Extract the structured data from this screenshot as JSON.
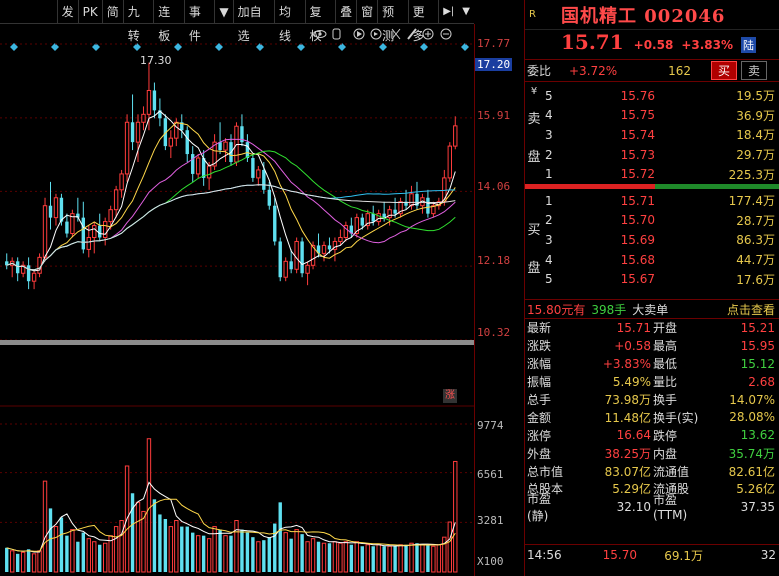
{
  "toolbar": {
    "buttons": [
      "发",
      "PK",
      "简",
      "九转",
      "连板",
      "事件",
      "▼",
      "加自选",
      "均线",
      "复权",
      "叠",
      "窗",
      "预测",
      "更多"
    ],
    "end_arrow": "▶|",
    "dropdown": "▼"
  },
  "price_axis": {
    "labels": [
      "17.77",
      "15.91",
      "14.06",
      "12.18",
      "10.32"
    ],
    "highlight": "17.20",
    "max_label": "17.30"
  },
  "volume_axis": {
    "labels": [
      "9774",
      "6561",
      "3281",
      "X100"
    ],
    "badge": "涨"
  },
  "quote": {
    "badge": "R",
    "name": "国机精工 002046",
    "price": "15.71",
    "change": "+0.58",
    "change_pct": "+3.83%",
    "exchange": "陆"
  },
  "weibi": {
    "label": "委比",
    "value": "+3.72%",
    "diff": "162",
    "buy_label": "买",
    "sell_label": "卖"
  },
  "sell_side": {
    "label": "卖盘",
    "top_mark": "¥",
    "rows": [
      {
        "level": "5",
        "price": "15.76",
        "volume": "19.5万"
      },
      {
        "level": "4",
        "price": "15.75",
        "volume": "36.9万"
      },
      {
        "level": "3",
        "price": "15.74",
        "volume": "18.4万"
      },
      {
        "level": "2",
        "price": "15.73",
        "volume": "29.7万"
      },
      {
        "level": "1",
        "price": "15.72",
        "volume": "225.3万"
      }
    ]
  },
  "buy_side": {
    "label": "买盘",
    "rows": [
      {
        "level": "1",
        "price": "15.71",
        "volume": "177.4万"
      },
      {
        "level": "2",
        "price": "15.70",
        "volume": "28.7万"
      },
      {
        "level": "3",
        "price": "15.69",
        "volume": "86.3万"
      },
      {
        "level": "4",
        "price": "15.68",
        "volume": "44.7万"
      },
      {
        "level": "5",
        "price": "15.67",
        "volume": "17.6万"
      }
    ]
  },
  "big_order": {
    "price": "15.80元有",
    "qty": "398手",
    "label": "大卖单",
    "link": "点击查看"
  },
  "stats": [
    {
      "l1": "最新",
      "v1": "15.71",
      "c1": "red",
      "l2": "开盘",
      "v2": "15.21",
      "c2": "red"
    },
    {
      "l1": "涨跌",
      "v1": "+0.58",
      "c1": "red",
      "l2": "最高",
      "v2": "15.95",
      "c2": "red"
    },
    {
      "l1": "涨幅",
      "v1": "+3.83%",
      "c1": "red",
      "l2": "最低",
      "v2": "15.12",
      "c2": "green"
    },
    {
      "l1": "振幅",
      "v1": "5.49%",
      "c1": "yellow",
      "l2": "量比",
      "v2": "2.68",
      "c2": "red"
    },
    {
      "l1": "总手",
      "v1": "73.98万",
      "c1": "yellow",
      "l2": "换手",
      "v2": "14.07%",
      "c2": "yellow"
    },
    {
      "l1": "金额",
      "v1": "11.48亿",
      "c1": "yellow",
      "l2": "换手(实)",
      "v2": "28.08%",
      "c2": "yellow"
    },
    {
      "l1": "涨停",
      "v1": "16.64",
      "c1": "red",
      "l2": "跌停",
      "v2": "13.62",
      "c2": "green"
    },
    {
      "l1": "外盘",
      "v1": "38.25万",
      "c1": "red",
      "l2": "内盘",
      "v2": "35.74万",
      "c2": "green"
    },
    {
      "l1": "总市值",
      "v1": "83.07亿",
      "c1": "yellow",
      "l2": "流通值",
      "v2": "82.61亿",
      "c2": "yellow"
    },
    {
      "l1": "总股本",
      "v1": "5.29亿",
      "c1": "yellow",
      "l2": "流通股",
      "v2": "5.26亿",
      "c2": "yellow"
    },
    {
      "l1": "市盈(静)",
      "v1": "32.10",
      "c1": "white",
      "l2": "市盈(TTM)",
      "v2": "37.35",
      "c2": "white"
    }
  ],
  "ticks": [
    {
      "time": "14:56",
      "price": "15.70",
      "vol": "69.1万",
      "n": "32"
    }
  ],
  "chart_data": {
    "type": "candlestick",
    "ylim": [
      10.32,
      17.77
    ],
    "candles": [
      [
        12.3,
        12.5,
        12.1,
        12.2
      ],
      [
        12.2,
        12.4,
        11.9,
        12.3
      ],
      [
        12.3,
        12.4,
        11.8,
        12.0
      ],
      [
        12.0,
        12.3,
        11.9,
        12.2
      ],
      [
        12.2,
        12.4,
        11.6,
        11.8
      ],
      [
        11.8,
        12.1,
        11.6,
        12.0
      ],
      [
        12.0,
        12.5,
        11.9,
        12.4
      ],
      [
        12.4,
        13.9,
        12.3,
        13.7
      ],
      [
        13.7,
        14.3,
        13.1,
        13.4
      ],
      [
        13.4,
        14.0,
        13.2,
        13.9
      ],
      [
        13.9,
        14.0,
        13.2,
        13.3
      ],
      [
        13.3,
        13.5,
        12.9,
        13.0
      ],
      [
        13.0,
        13.6,
        12.9,
        13.5
      ],
      [
        13.5,
        13.9,
        13.3,
        13.4
      ],
      [
        13.4,
        13.8,
        12.5,
        12.6
      ],
      [
        12.6,
        13.2,
        12.4,
        12.9
      ],
      [
        12.9,
        13.3,
        12.5,
        13.2
      ],
      [
        13.2,
        13.5,
        12.8,
        12.9
      ],
      [
        12.9,
        13.4,
        12.7,
        13.3
      ],
      [
        13.3,
        13.7,
        13.1,
        13.6
      ],
      [
        13.6,
        14.2,
        13.4,
        14.1
      ],
      [
        14.1,
        14.6,
        13.9,
        14.5
      ],
      [
        14.5,
        16.0,
        14.3,
        15.8
      ],
      [
        15.8,
        16.5,
        15.1,
        15.3
      ],
      [
        15.3,
        16.0,
        14.8,
        15.8
      ],
      [
        15.8,
        16.2,
        15.6,
        16.0
      ],
      [
        16.0,
        17.3,
        15.6,
        16.6
      ],
      [
        16.6,
        16.8,
        15.9,
        16.1
      ],
      [
        16.1,
        16.4,
        15.7,
        15.9
      ],
      [
        15.9,
        16.0,
        15.1,
        15.2
      ],
      [
        15.2,
        15.6,
        14.9,
        15.4
      ],
      [
        15.4,
        15.9,
        15.2,
        15.8
      ],
      [
        15.8,
        16.0,
        15.4,
        15.6
      ],
      [
        15.6,
        15.7,
        14.8,
        15.0
      ],
      [
        15.0,
        15.2,
        14.3,
        14.5
      ],
      [
        14.5,
        15.0,
        14.4,
        14.9
      ],
      [
        14.9,
        15.1,
        14.2,
        14.4
      ],
      [
        14.4,
        14.8,
        14.1,
        14.7
      ],
      [
        14.7,
        15.5,
        14.6,
        15.3
      ],
      [
        15.3,
        15.8,
        15.0,
        15.1
      ],
      [
        15.1,
        15.4,
        14.8,
        15.3
      ],
      [
        15.3,
        15.5,
        14.7,
        14.8
      ],
      [
        14.8,
        15.8,
        14.7,
        15.7
      ],
      [
        15.7,
        16.0,
        15.2,
        15.3
      ],
      [
        15.3,
        15.5,
        14.8,
        14.9
      ],
      [
        14.9,
        15.0,
        14.3,
        14.4
      ],
      [
        14.4,
        14.7,
        14.2,
        14.6
      ],
      [
        14.6,
        14.8,
        14.0,
        14.1
      ],
      [
        14.1,
        14.3,
        13.6,
        13.7
      ],
      [
        13.7,
        13.9,
        12.7,
        12.8
      ],
      [
        12.8,
        12.9,
        11.8,
        11.9
      ],
      [
        11.9,
        12.4,
        11.8,
        12.3
      ],
      [
        12.3,
        12.6,
        12.0,
        12.1
      ],
      [
        12.1,
        12.9,
        12.0,
        12.8
      ],
      [
        12.8,
        12.9,
        11.9,
        12.0
      ],
      [
        12.0,
        12.3,
        11.7,
        12.2
      ],
      [
        12.2,
        12.8,
        12.1,
        12.7
      ],
      [
        12.7,
        13.0,
        12.4,
        12.5
      ],
      [
        12.5,
        12.8,
        12.3,
        12.7
      ],
      [
        12.7,
        12.9,
        12.5,
        12.6
      ],
      [
        12.6,
        12.9,
        12.3,
        12.8
      ],
      [
        12.8,
        13.1,
        12.7,
        12.9
      ],
      [
        12.9,
        13.3,
        12.8,
        13.2
      ],
      [
        13.2,
        13.4,
        12.9,
        13.0
      ],
      [
        13.0,
        13.5,
        12.9,
        13.4
      ],
      [
        13.4,
        13.5,
        13.1,
        13.2
      ],
      [
        13.2,
        13.6,
        13.1,
        13.5
      ],
      [
        13.5,
        13.7,
        13.2,
        13.3
      ],
      [
        13.3,
        13.6,
        13.2,
        13.5
      ],
      [
        13.5,
        13.8,
        13.3,
        13.4
      ],
      [
        13.4,
        13.7,
        13.2,
        13.6
      ],
      [
        13.6,
        13.9,
        13.4,
        13.5
      ],
      [
        13.5,
        13.9,
        13.4,
        13.8
      ],
      [
        13.8,
        14.1,
        13.6,
        13.7
      ],
      [
        13.7,
        14.2,
        13.6,
        14.0
      ],
      [
        14.0,
        14.3,
        13.6,
        13.7
      ],
      [
        13.7,
        14.0,
        13.5,
        13.9
      ],
      [
        13.9,
        14.1,
        13.4,
        13.5
      ],
      [
        13.5,
        13.8,
        13.4,
        13.7
      ],
      [
        13.7,
        13.9,
        13.6,
        13.8
      ],
      [
        13.8,
        14.6,
        13.7,
        14.4
      ],
      [
        14.4,
        15.3,
        14.3,
        15.2
      ],
      [
        15.2,
        15.95,
        15.12,
        15.71
      ]
    ],
    "volume_ylim": [
      0,
      9774
    ],
    "volumes": [
      1600,
      1400,
      1200,
      1300,
      1500,
      1200,
      1400,
      6000,
      4200,
      3000,
      3600,
      2400,
      2800,
      2000,
      2600,
      2200,
      2000,
      1800,
      1900,
      2400,
      3000,
      3400,
      7000,
      5200,
      4600,
      4000,
      8800,
      4800,
      3800,
      3500,
      3000,
      3400,
      3000,
      3000,
      2600,
      2400,
      2400,
      2200,
      3000,
      2800,
      2400,
      2400,
      3400,
      2800,
      2600,
      2300,
      2000,
      2100,
      2300,
      3200,
      4600,
      2600,
      2200,
      2800,
      2500,
      2000,
      2200,
      2000,
      1900,
      1900,
      2000,
      1900,
      2000,
      1800,
      2000,
      1700,
      1800,
      1700,
      1800,
      1700,
      1700,
      1700,
      1800,
      1800,
      1900,
      1900,
      1800,
      1800,
      1700,
      1800,
      2300,
      3300,
      7300
    ]
  }
}
